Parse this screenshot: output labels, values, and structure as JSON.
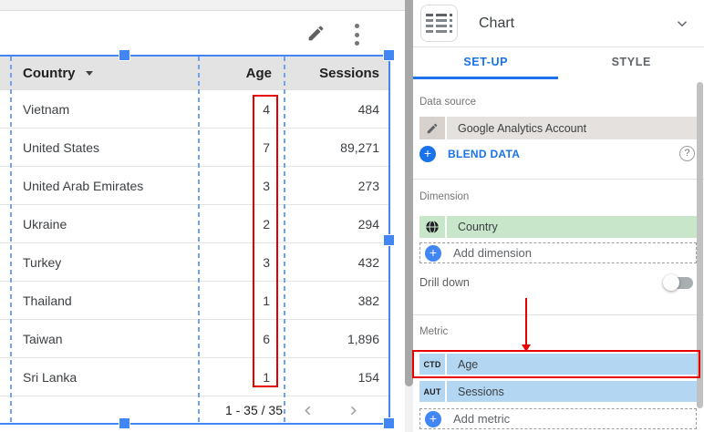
{
  "canvas": {
    "table": {
      "header": {
        "country": "Country",
        "age": "Age",
        "sessions": "Sessions"
      },
      "rows": [
        {
          "country": "Vietnam",
          "age": "4",
          "sessions": "484"
        },
        {
          "country": "United States",
          "age": "7",
          "sessions": "89,271"
        },
        {
          "country": "United Arab Emirates",
          "age": "3",
          "sessions": "273"
        },
        {
          "country": "Ukraine",
          "age": "2",
          "sessions": "294"
        },
        {
          "country": "Turkey",
          "age": "3",
          "sessions": "432"
        },
        {
          "country": "Thailand",
          "age": "1",
          "sessions": "382"
        },
        {
          "country": "Taiwan",
          "age": "6",
          "sessions": "1,896"
        },
        {
          "country": "Sri Lanka",
          "age": "1",
          "sessions": "154"
        }
      ],
      "footer": {
        "range": "1 - 35 / 35"
      }
    }
  },
  "panel": {
    "header": {
      "title": "Chart"
    },
    "tabs": {
      "setup": "SET-UP",
      "style": "STYLE"
    },
    "data_source": {
      "label": "Data source",
      "name": "Google Analytics Account",
      "blend_label": "BLEND DATA",
      "help": "?"
    },
    "dimension": {
      "label": "Dimension",
      "chip": "Country",
      "add_label": "Add dimension"
    },
    "drill_down": {
      "label": "Drill down"
    },
    "metric": {
      "label": "Metric",
      "chips": [
        {
          "badge": "CTD",
          "name": "Age"
        },
        {
          "badge": "AUT",
          "name": "Sessions"
        }
      ],
      "add_label": "Add metric"
    },
    "plus": "+"
  },
  "colors": {
    "selection_blue": "#4285f4",
    "link_blue": "#1a73e8",
    "annotation_red": "#e60000",
    "dimension_green": "#c8e6c9",
    "metric_blue": "#b3d7f3",
    "datasource_beige": "#e5e1de",
    "table_header_gray": "#e3e3e3"
  }
}
